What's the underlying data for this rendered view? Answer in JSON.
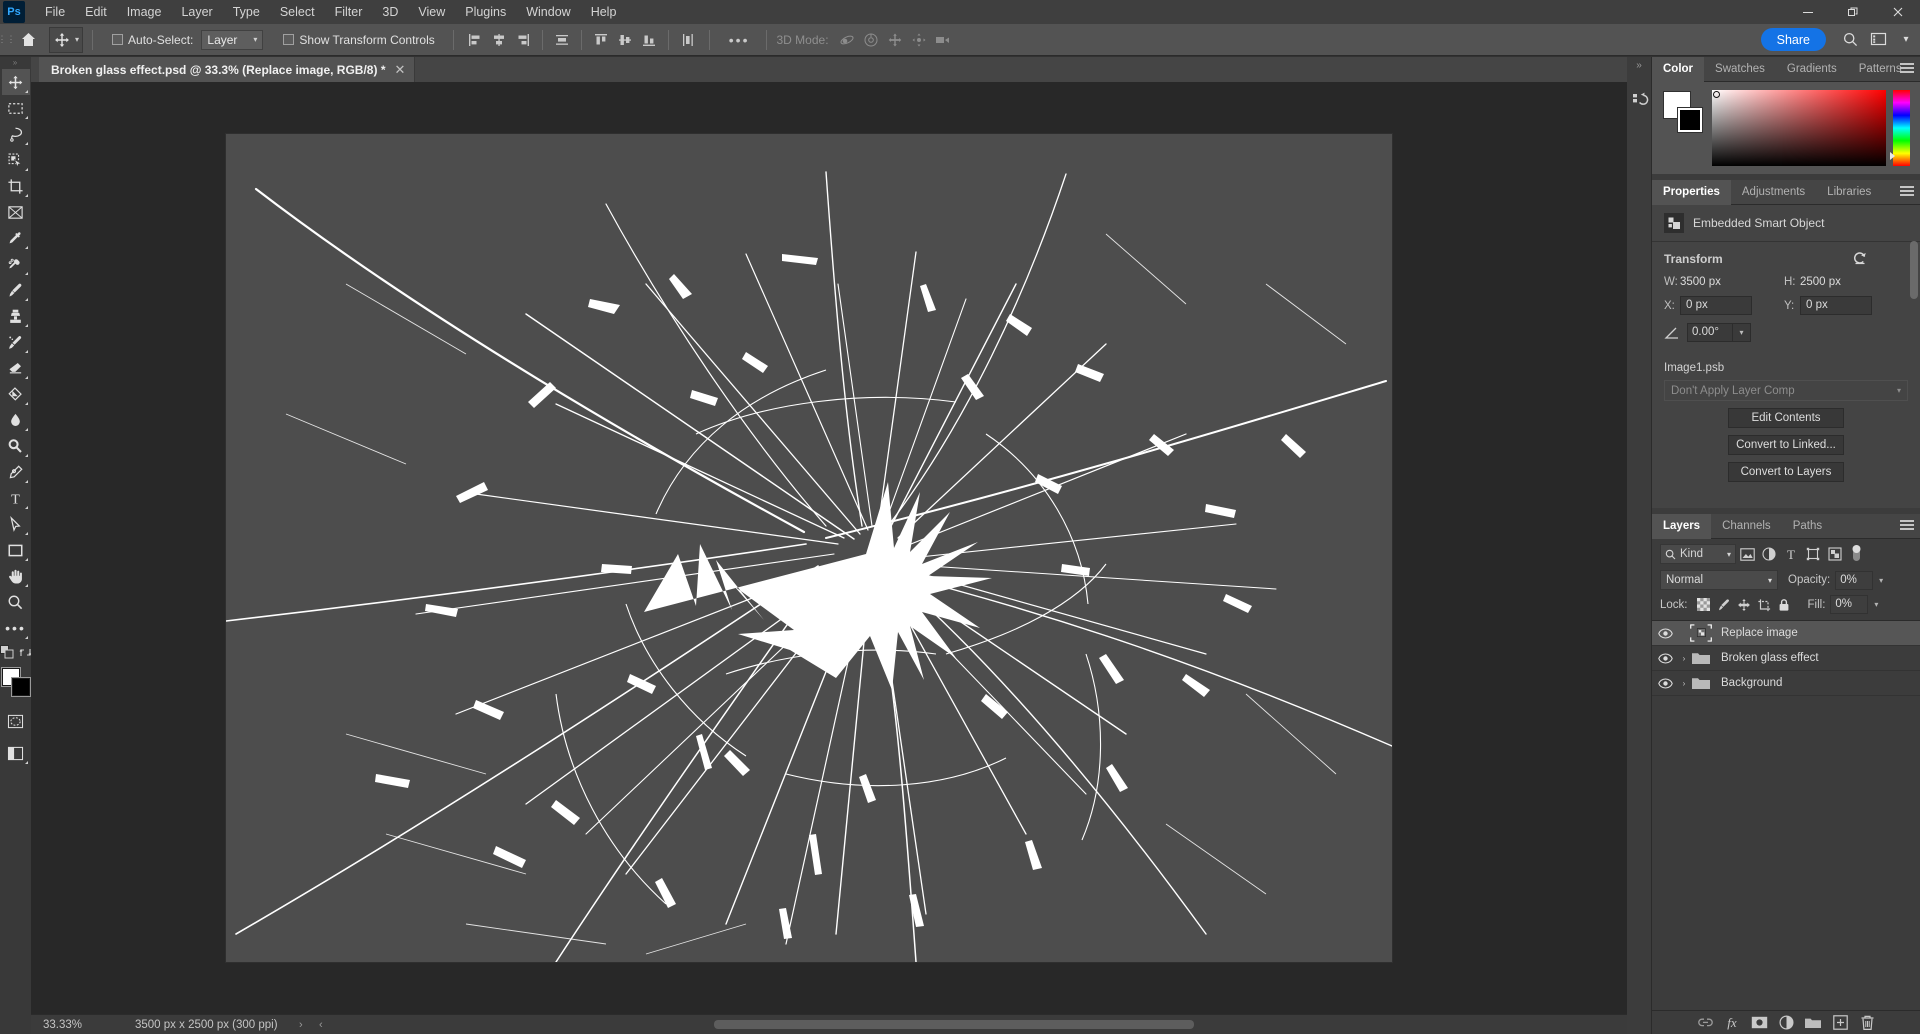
{
  "app": {
    "name": "Adobe Photoshop",
    "logo_text": "Ps"
  },
  "titlebar": {
    "menus": [
      "File",
      "Edit",
      "Image",
      "Layer",
      "Type",
      "Select",
      "Filter",
      "3D",
      "View",
      "Plugins",
      "Window",
      "Help"
    ],
    "window_controls": [
      {
        "name": "minimize",
        "glyph": "—"
      },
      {
        "name": "restore",
        "glyph": "❐"
      },
      {
        "name": "close",
        "glyph": "✕"
      }
    ]
  },
  "options_bar": {
    "home_icon": "home-icon",
    "tool_icon": "move-tool-icon",
    "auto_select_label": "Auto-Select:",
    "auto_select_checked": false,
    "auto_select_scope": "Layer",
    "show_transform_label": "Show Transform Controls",
    "show_transform_checked": false,
    "align_icons": [
      "align-left-edges-icon",
      "align-horizontal-centers-icon",
      "align-right-edges-icon",
      "distribute-horizontally-icon",
      "align-top-edges-icon",
      "align-vertical-centers-icon",
      "align-bottom-edges-icon",
      "distribute-vertically-icon"
    ],
    "more_label": "•••",
    "mode3d_label": "3D Mode:",
    "mode3d_icons": [
      "orbit-3d-icon",
      "roll-3d-icon",
      "pan-3d-icon",
      "slide-3d-icon",
      "camera-3d-icon"
    ],
    "share_label": "Share",
    "search_icon": "search-icon",
    "workspace_icon": "workspace-switcher-icon",
    "chevron_icon": "chevron-down-icon"
  },
  "toolbar": {
    "tools": [
      {
        "name": "move-tool",
        "icon": "move-icon",
        "active": true,
        "flyout": true
      },
      {
        "name": "rectangular-marquee-tool",
        "icon": "marquee-icon",
        "active": false,
        "flyout": true
      },
      {
        "name": "lasso-tool",
        "icon": "lasso-icon",
        "active": false,
        "flyout": true
      },
      {
        "name": "object-selection-tool",
        "icon": "quick-selection-icon",
        "active": false,
        "flyout": true
      },
      {
        "name": "crop-tool",
        "icon": "crop-icon",
        "active": false,
        "flyout": true
      },
      {
        "name": "frame-tool",
        "icon": "frame-icon",
        "active": false,
        "flyout": false
      },
      {
        "name": "eyedropper-tool",
        "icon": "eyedropper-icon",
        "active": false,
        "flyout": true
      },
      {
        "name": "spot-healing-brush-tool",
        "icon": "healing-brush-icon",
        "active": false,
        "flyout": true
      },
      {
        "name": "brush-tool",
        "icon": "brush-icon",
        "active": false,
        "flyout": true
      },
      {
        "name": "clone-stamp-tool",
        "icon": "clone-stamp-icon",
        "active": false,
        "flyout": true
      },
      {
        "name": "history-brush-tool",
        "icon": "history-brush-icon",
        "active": false,
        "flyout": true
      },
      {
        "name": "eraser-tool",
        "icon": "eraser-icon",
        "active": false,
        "flyout": true
      },
      {
        "name": "gradient-tool",
        "icon": "gradient-bucket-icon",
        "active": false,
        "flyout": true
      },
      {
        "name": "blur-tool",
        "icon": "blur-drop-icon",
        "active": false,
        "flyout": true
      },
      {
        "name": "dodge-tool",
        "icon": "dodge-icon",
        "active": false,
        "flyout": true
      },
      {
        "name": "pen-tool",
        "icon": "pen-icon",
        "active": false,
        "flyout": true
      },
      {
        "name": "type-tool",
        "icon": "type-icon",
        "active": false,
        "flyout": true
      },
      {
        "name": "path-selection-tool",
        "icon": "path-selection-arrow-icon",
        "active": false,
        "flyout": true
      },
      {
        "name": "rectangle-tool",
        "icon": "rectangle-shape-icon",
        "active": false,
        "flyout": true
      },
      {
        "name": "hand-tool",
        "icon": "hand-icon",
        "active": false,
        "flyout": true
      },
      {
        "name": "zoom-tool",
        "icon": "zoom-magnifier-icon",
        "active": false,
        "flyout": false
      },
      {
        "name": "edit-toolbar",
        "icon": "ellipsis-icon",
        "active": false,
        "flyout": true
      }
    ],
    "default_colors_icon": "default-colors-icon",
    "swap_colors_icon": "swap-colors-icon",
    "foreground_color": "#ffffff",
    "background_color": "#000000",
    "quick_mask_icon": "quick-mask-icon",
    "screen_mode_icon": "screen-mode-icon"
  },
  "document": {
    "tab_title": "Broken glass effect.psd @ 33.3% (Replace image, RGB/8) *",
    "close_glyph": "✕",
    "canvas_bg": "#4d4d4d",
    "crack_color": "#ffffff"
  },
  "statusbar": {
    "zoom": "33.33%",
    "doc_size": "3500 px x 2500 px (300 ppi)",
    "arrow_right": "›",
    "arrow_left": "‹"
  },
  "dock_strip": {
    "collapse_icon": "double-chevron-right-icon",
    "history_icon": "history-panel-icon"
  },
  "color_panel": {
    "tabs": [
      {
        "label": "Color",
        "active": true
      },
      {
        "label": "Swatches",
        "active": false
      },
      {
        "label": "Gradients",
        "active": false
      },
      {
        "label": "Patterns",
        "active": false
      }
    ],
    "menu_icon": "panel-menu-icon",
    "foreground": "#ffffff",
    "background": "#000000"
  },
  "properties_panel": {
    "tabs": [
      {
        "label": "Properties",
        "active": true
      },
      {
        "label": "Adjustments",
        "active": false
      },
      {
        "label": "Libraries",
        "active": false
      }
    ],
    "menu_icon": "panel-menu-icon",
    "object_type": "Embedded Smart Object",
    "object_icon": "smart-object-icon",
    "transform_label": "Transform",
    "reset_icon": "reset-transform-icon",
    "w_label": "W:",
    "w_value": "3500 px",
    "h_label": "H:",
    "h_value": "2500 px",
    "x_label": "X:",
    "x_value": "0 px",
    "y_label": "Y:",
    "y_value": "0 px",
    "angle_icon": "angle-icon",
    "angle_value": "0.00°",
    "psb_name": "Image1.psb",
    "layer_comp": "Don't Apply Layer Comp",
    "buttons": [
      "Edit Contents",
      "Convert to Linked...",
      "Convert to Layers"
    ]
  },
  "layers_panel": {
    "tabs": [
      {
        "label": "Layers",
        "active": true
      },
      {
        "label": "Channels",
        "active": false
      },
      {
        "label": "Paths",
        "active": false
      }
    ],
    "menu_icon": "panel-menu-icon",
    "filter_label": "Kind",
    "filter_search_icon": "search-icon",
    "filter_icons": [
      "filter-pixel-icon",
      "filter-adjustment-icon",
      "filter-type-icon",
      "filter-shape-icon",
      "filter-smart-object-icon"
    ],
    "filter_toggle_icon": "filter-toggle-icon",
    "blend_mode": "Normal",
    "opacity_label": "Opacity:",
    "opacity_value": "0%",
    "fill_label": "Fill:",
    "fill_value": "0%",
    "lock_label": "Lock:",
    "lock_icons": [
      "lock-transparent-pixels-icon",
      "lock-image-pixels-icon",
      "lock-position-icon",
      "lock-artboard-nesting-icon",
      "lock-all-icon"
    ],
    "layers": [
      {
        "name": "Replace image",
        "type": "smart-object",
        "visible": true,
        "selected": true,
        "expandable": false
      },
      {
        "name": "Broken glass effect",
        "type": "group",
        "visible": true,
        "selected": false,
        "expandable": true
      },
      {
        "name": "Background",
        "type": "group",
        "visible": true,
        "selected": false,
        "expandable": true
      }
    ],
    "footer_icons": [
      "link-layers-icon",
      "layer-style-fx-icon",
      "add-layer-mask-icon",
      "new-adjustment-layer-icon",
      "new-group-icon",
      "new-layer-icon",
      "delete-layer-icon"
    ]
  }
}
